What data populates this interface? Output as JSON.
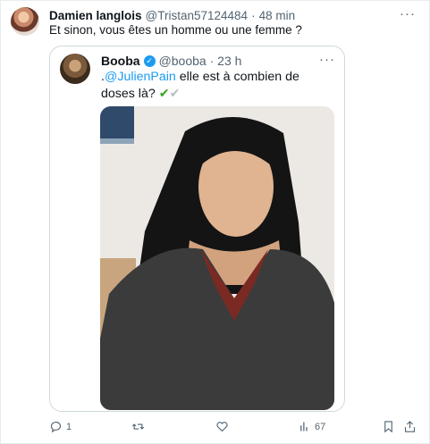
{
  "tweet": {
    "author_name": "Damien langlois",
    "author_handle": "@Tristan57124484",
    "time": "48 min",
    "text": "Et sinon, vous êtes un homme ou une femme ?",
    "more": "···"
  },
  "quoted": {
    "author_name": "Booba",
    "verified_mark": "✓",
    "author_handle": "@booba",
    "time": "23 h",
    "text_prefix": ".",
    "mention": "@JulienPain",
    "text_rest": " elle est à combien de doses là?",
    "emoji_1": "✔",
    "emoji_2": "✔",
    "more": "···"
  },
  "actions": {
    "reply_count": "1",
    "retweet_count": "",
    "like_count": "",
    "views_count": "67"
  },
  "colors": {
    "accent": "#1d9bf0",
    "text": "#0f1419",
    "secondary": "#536471",
    "border": "#cfd9de"
  }
}
